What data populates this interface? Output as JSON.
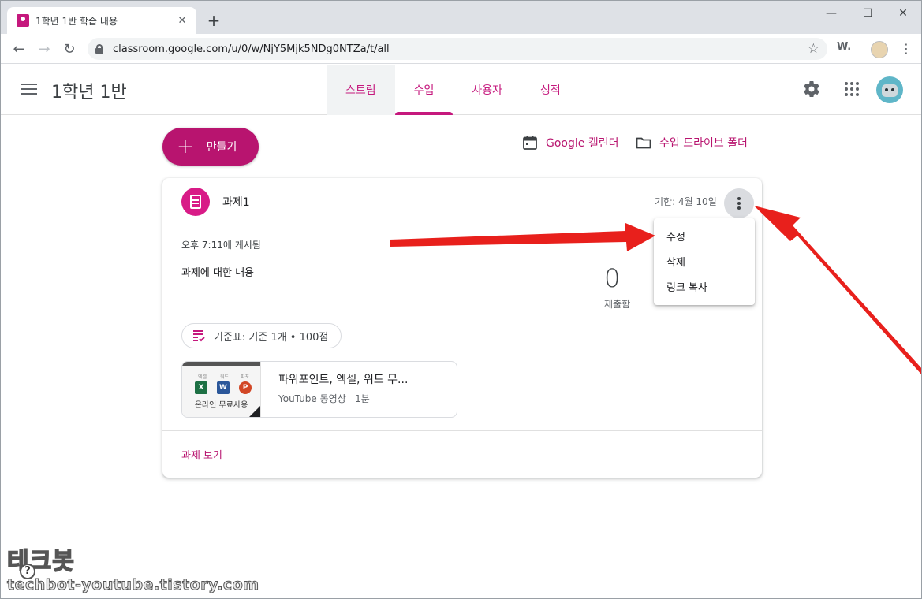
{
  "browser": {
    "tab_title": "1학년 1반 학습 내용",
    "tab_close": "✕",
    "new_tab": "+",
    "url": "classroom.google.com/u/0/w/NjY5Mjk5NDg0NTZa/t/all",
    "ext_label": "W.",
    "win_min": "—",
    "win_max": "☐",
    "win_close": "✕",
    "back": "←",
    "forward": "→",
    "reload": "↻",
    "star": "☆",
    "menu": "⋮"
  },
  "header": {
    "class_title": "1학년 1반",
    "tabs": [
      {
        "label": "스트림"
      },
      {
        "label": "수업"
      },
      {
        "label": "사용자"
      },
      {
        "label": "성적"
      }
    ]
  },
  "actions": {
    "create_label": "만들기",
    "create_plus": "+",
    "calendar_label": "Google 캘린더",
    "drive_label": "수업 드라이브 폴더"
  },
  "assignment": {
    "title": "과제1",
    "due": "기한: 4월 10일",
    "posted": "오후 7:11에 게시됨",
    "description": "과제에 대한 내용",
    "submitted_count": "0",
    "submitted_label": "제출함",
    "rubric": "기준표: 기준 1개 • 100점",
    "attachment": {
      "title": "파워포인트, 엑셀, 워드 무...",
      "subtitle": "YouTube 동영상   1분",
      "thumb_caption": "온라인 무료사용",
      "thumb_labels": [
        "엑셀",
        "워드",
        "파포"
      ],
      "thumb_apps": [
        "X",
        "W",
        "P"
      ]
    },
    "view_link": "과제 보기"
  },
  "menu": {
    "items": [
      {
        "label": "수정"
      },
      {
        "label": "삭제"
      },
      {
        "label": "링크 복사"
      }
    ]
  },
  "watermark": {
    "title": "테크봇",
    "help": "?",
    "url": "techbot-youtube.tistory.com"
  },
  "colors": {
    "accent": "#b8146f",
    "arrow": "#e8201c"
  }
}
